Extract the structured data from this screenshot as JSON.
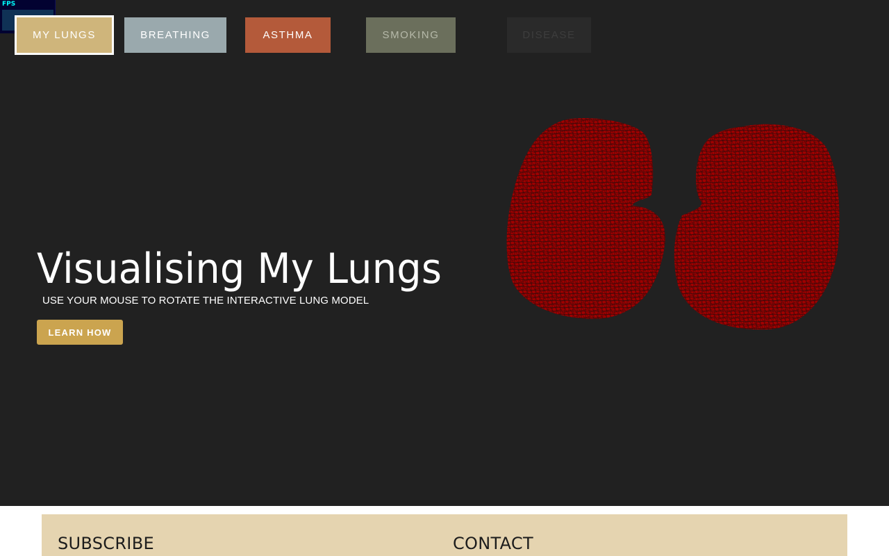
{
  "fps_meter": {
    "label": "FPS"
  },
  "nav": {
    "items": [
      {
        "label": "MY LUNGS",
        "color": "#cfb57b",
        "active": true
      },
      {
        "label": "BREATHING",
        "color": "#9aa9ad"
      },
      {
        "label": "ASTHMA",
        "color": "#b45a3a"
      },
      {
        "label": "SMOKING",
        "color": "#6b6f5c"
      },
      {
        "label": "DISEASE",
        "color": "#2a2a2a"
      }
    ]
  },
  "hero": {
    "title": "Visualising My Lungs",
    "subtitle": "USE YOUR MOUSE TO ROTATE THE INTERACTIVE LUNG MODEL",
    "cta_label": "LEARN HOW",
    "background": "#212121",
    "model_color": "#a00000"
  },
  "footer": {
    "subscribe_heading": "SUBSCRIBE",
    "contact_heading": "CONTACT",
    "background": "#e5d4b0"
  }
}
